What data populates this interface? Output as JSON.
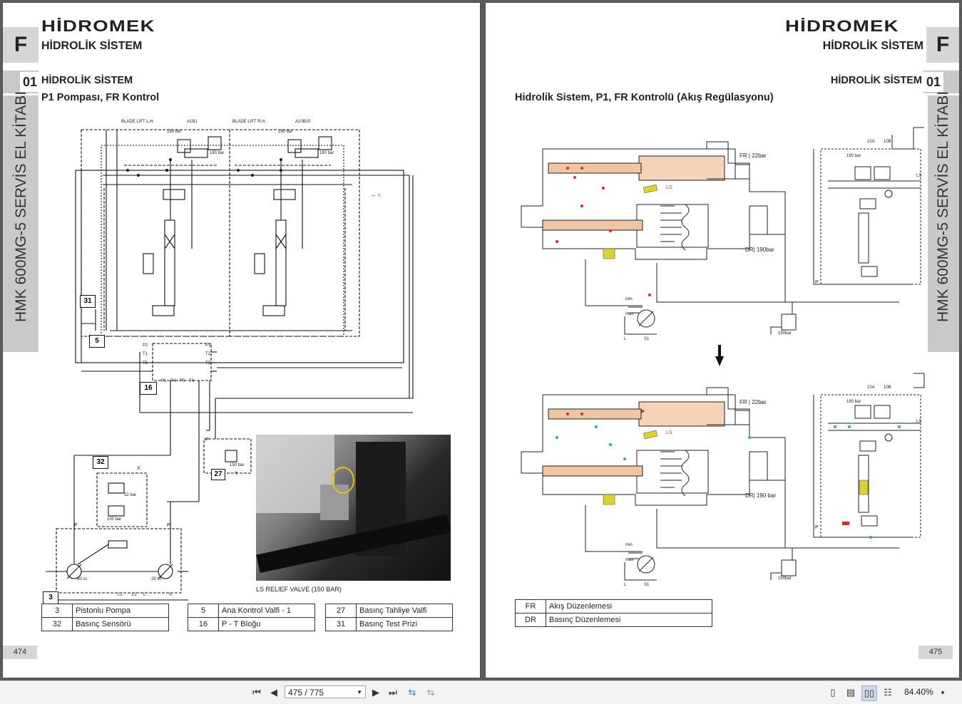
{
  "viewer": {
    "page_value": "475 / 775",
    "zoom_value": "84.40%"
  },
  "left_page": {
    "section_letter": "F",
    "chapter_number": "01",
    "logo_text": "HİDROMEK",
    "header_title": "HİDROLİK SİSTEM",
    "section_title": "HİDROLİK SİSTEM",
    "section_subtitle": "P1 Pompası, FR Kontrol",
    "side_title": "HMK 600MG-5 SERVİS EL KİTABI",
    "page_number": "474",
    "photo_caption": "LS RELIEF VALVE (150 BAR)",
    "callouts": [
      "31",
      "5",
      "16",
      "32",
      "27",
      "3"
    ],
    "schematic_labels": {
      "blade_lift_lh": "BLADE LIFT L.H.",
      "a1b1": "A1B1",
      "blade_lift_rh": "BLADE LIFT R.H.",
      "a10b10": "A10B10",
      "bar180a": "180 bar",
      "bar180b": "180 bar",
      "bar180c": "180 bar",
      "bar180d": "180 bar",
      "p2": "P2",
      "t1": "T1",
      "t5": "T5",
      "p3": "P3",
      "t2": "T2",
      "t3": "T3",
      "p1": "P1",
      "p4": "P4",
      "p5": "P5",
      "t4": "T4",
      "p_a": "P",
      "t_a": "T",
      "p_b": "P",
      "p_c": "P",
      "x": "X",
      "cc60": "60 cc",
      "cc28": "28 cc",
      "s": "S",
      "l2": "L2",
      "l1": "L1",
      "l": "L",
      "bar150": "150 bar",
      "bar32": "32 bar",
      "bar100": "100 bar"
    },
    "legend": [
      {
        "num": "3",
        "label": "Pistonlu Pompa"
      },
      {
        "num": "32",
        "label": "Basınç  Sensörü"
      },
      {
        "num": "5",
        "label": "Ana Kontrol Valfi - 1"
      },
      {
        "num": "16",
        "label": "P - T Bloğu"
      },
      {
        "num": "27",
        "label": "Basınç Tahliye Valfi"
      },
      {
        "num": "31",
        "label": "Basınç Test Prizi"
      }
    ]
  },
  "right_page": {
    "section_letter": "F",
    "chapter_number": "01",
    "logo_text": "HİDROMEK",
    "header_title": "HİDROLİK SİSTEM",
    "section_title": "HİDROLİK SİSTEM",
    "section_subtitle": "Hidrolik Sistem, P1, FR Kontrolü (Akış Regülasyonu)",
    "side_title": "HMK 600MG-5 SERVİS EL KİTABI",
    "page_number": "475",
    "diagram_labels": {
      "fr_top": "FR | 22bar",
      "dr_top": "DR| 190bar",
      "ls_top": "LS",
      "fr_bottom": "FR | 22bar",
      "dr_bottom": "DR| 190 bar",
      "ls_bottom": "LS",
      "bar190a": "190 bar",
      "bar190b": "190 bar",
      "a10a": "10A",
      "b10a": "10B",
      "a10b": "10A",
      "b10b": "10B",
      "ls_r1": "LS",
      "ls_r2": "LS",
      "p1": "P",
      "p2": "P",
      "min1": "min",
      "max1": "max",
      "min2": "min",
      "max2": "max",
      "bar150a": "150bar",
      "bar150b": "150bar",
      "l1": "L",
      "s1": "S1",
      "l2": "L",
      "s2": "S1"
    },
    "legend": [
      {
        "code": "FR",
        "label": "Akış Düzenlemesi"
      },
      {
        "code": "DR",
        "label": "Basınç Düzenlemesi"
      }
    ]
  }
}
